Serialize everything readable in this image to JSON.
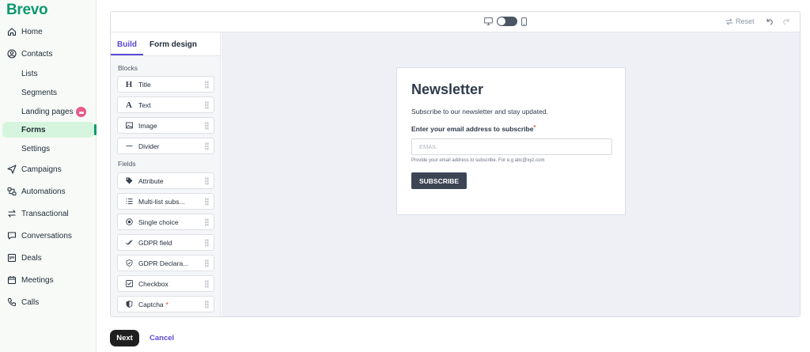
{
  "brand": {
    "name": "Brevo",
    "color": "#0b996e"
  },
  "nav": {
    "home": "Home",
    "contacts": "Contacts",
    "lists": "Lists",
    "segments": "Segments",
    "landing_pages": "Landing pages",
    "forms": "Forms",
    "settings": "Settings",
    "campaigns": "Campaigns",
    "automations": "Automations",
    "transactional": "Transactional",
    "conversations": "Conversations",
    "deals": "Deals",
    "meetings": "Meetings",
    "calls": "Calls",
    "active_item": "Forms"
  },
  "toolbar": {
    "device_icons": [
      "desktop-icon",
      "mobile-icon"
    ],
    "reset_label": "Reset"
  },
  "tabs": {
    "build": "Build",
    "form_design": "Form design",
    "active": "Build"
  },
  "blocks_section": {
    "label": "Blocks",
    "items": [
      {
        "label": "Title",
        "icon": "heading-icon"
      },
      {
        "label": "Text",
        "icon": "text-icon"
      },
      {
        "label": "Image",
        "icon": "image-icon"
      },
      {
        "label": "Divider",
        "icon": "divider-icon"
      }
    ]
  },
  "fields_section": {
    "label": "Fields",
    "items": [
      {
        "label": "Attribute",
        "icon": "tag-icon"
      },
      {
        "label": "Multi-list subs...",
        "icon": "list-icon"
      },
      {
        "label": "Single choice",
        "icon": "radio-icon"
      },
      {
        "label": "GDPR field",
        "icon": "check-double-icon"
      },
      {
        "label": "GDPR Declara...",
        "icon": "shield-check-icon"
      },
      {
        "label": "Checkbox",
        "icon": "checkbox-icon"
      },
      {
        "label": "Captcha",
        "icon": "shield-icon",
        "required_mark": "*"
      }
    ]
  },
  "form_preview": {
    "title": "Newsletter",
    "subtitle": "Subscribe to our newsletter and stay updated.",
    "field_label": "Enter your email address to subscribe",
    "required_mark": "*",
    "email_placeholder": "EMAIL",
    "help_text": "Provide your email address to subscribe. For e.g abc@xyz.com",
    "button_label": "SUBSCRIBE"
  },
  "footer": {
    "next_label": "Next",
    "cancel_label": "Cancel"
  },
  "colors": {
    "accent": "#5b49d6",
    "active_nav_bg": "#d6f5de",
    "required": "#e3342f",
    "button_dark": "#3b4554"
  }
}
